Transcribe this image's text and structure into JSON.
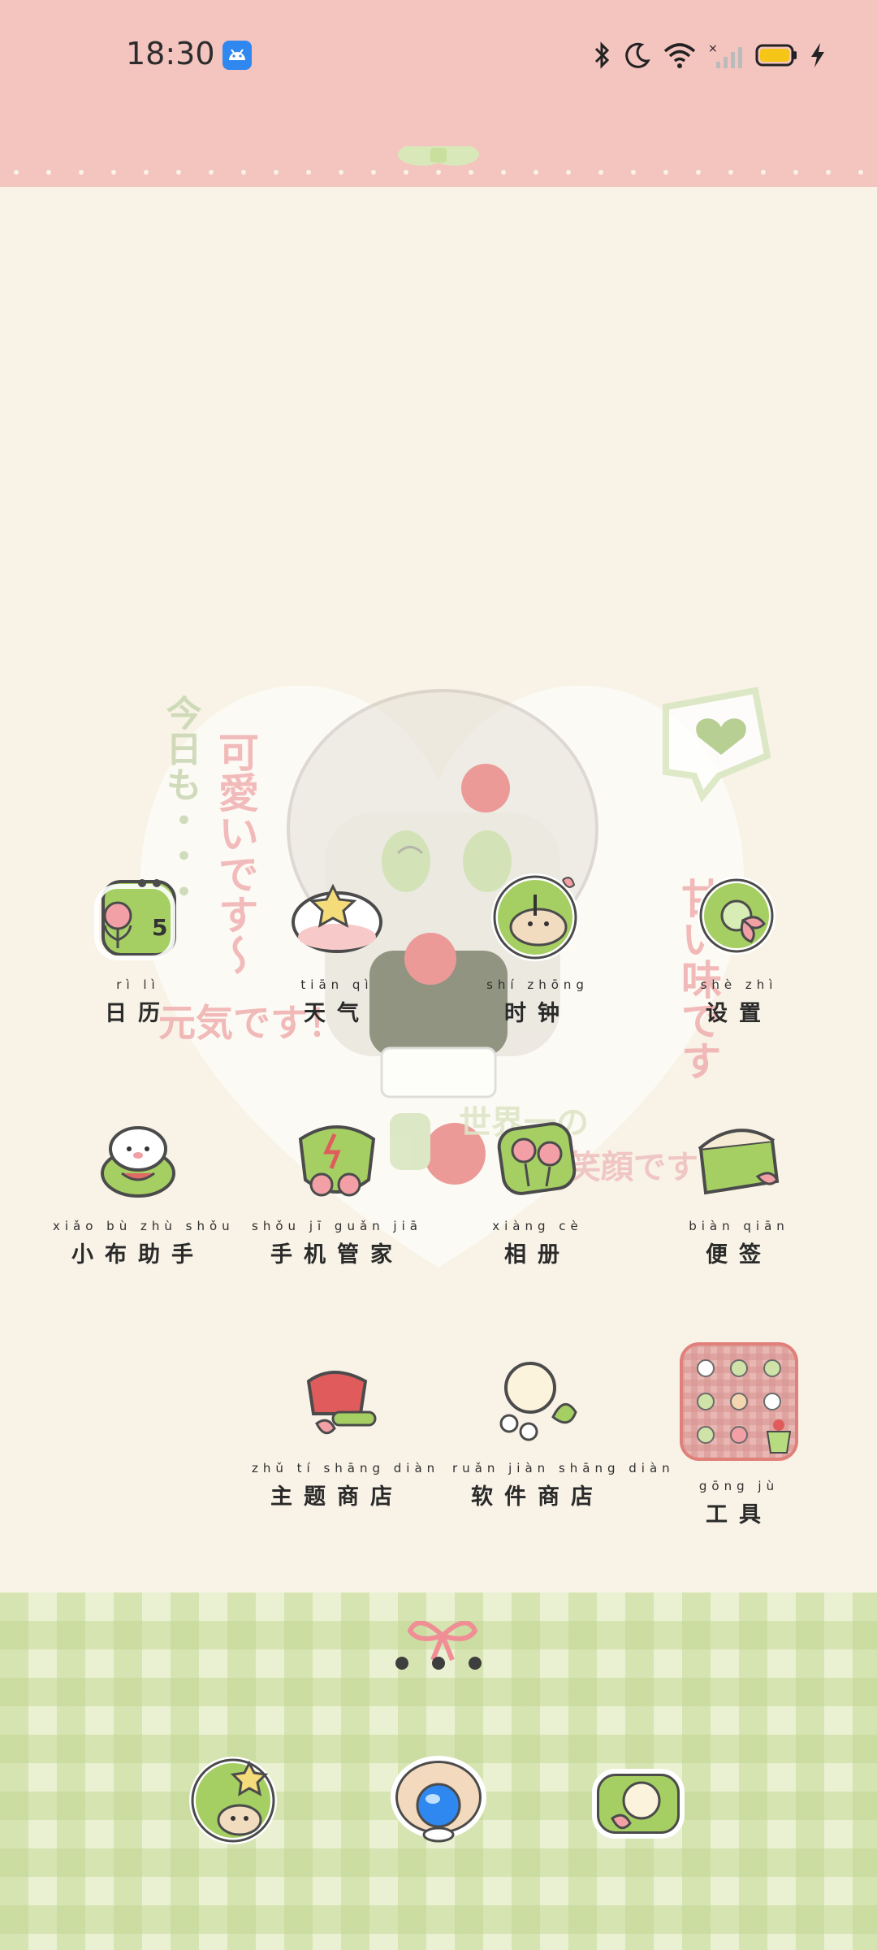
{
  "status_bar": {
    "time": "18:30",
    "icons": [
      "android-notification-icon",
      "bluetooth-icon",
      "do-not-disturb-moon-icon",
      "wifi-icon",
      "no-sim-signal-icon",
      "battery-icon",
      "charging-bolt-icon"
    ]
  },
  "wallpaper": {
    "texts": [
      "今日も・・・",
      "可愛いです～",
      "元気です！",
      "世界一の",
      "笑顔です",
      "甘い味です"
    ]
  },
  "apps": [
    {
      "label": "日历",
      "pinyin": "rì lì",
      "icon": "calendar-icon",
      "day": "5"
    },
    {
      "label": "天气",
      "pinyin": "tiān qì",
      "icon": "weather-icon"
    },
    {
      "label": "时钟",
      "pinyin": "shí zhōng",
      "icon": "clock-icon"
    },
    {
      "label": "设置",
      "pinyin": "shè zhì",
      "icon": "settings-icon"
    },
    {
      "label": "小布助手",
      "pinyin": "xiǎo bù zhù shǒu",
      "icon": "assistant-icon"
    },
    {
      "label": "手机管家",
      "pinyin": "shǒu jī guǎn jiā",
      "icon": "phone-manager-icon"
    },
    {
      "label": "相册",
      "pinyin": "xiàng cè",
      "icon": "gallery-icon"
    },
    {
      "label": "便签",
      "pinyin": "biàn qiān",
      "icon": "notes-icon"
    },
    {
      "label": "主题商店",
      "pinyin": "zhǔ tí shāng diàn",
      "icon": "theme-store-icon"
    },
    {
      "label": "软件商店",
      "pinyin": "ruǎn jiàn shāng diàn",
      "icon": "app-store-icon"
    },
    {
      "label": "工具",
      "pinyin": "gōng jù",
      "icon": "tools-folder-icon"
    }
  ],
  "dock": [
    {
      "icon": "phone-icon"
    },
    {
      "icon": "browser-icon"
    },
    {
      "icon": "camera-icon"
    }
  ],
  "colors": {
    "top_band": "#f4c4bf",
    "background": "#f8f3e6",
    "accent_green": "#a6cf63",
    "accent_pink": "#f2a0a6",
    "dock_check": "#eaf0d2"
  }
}
